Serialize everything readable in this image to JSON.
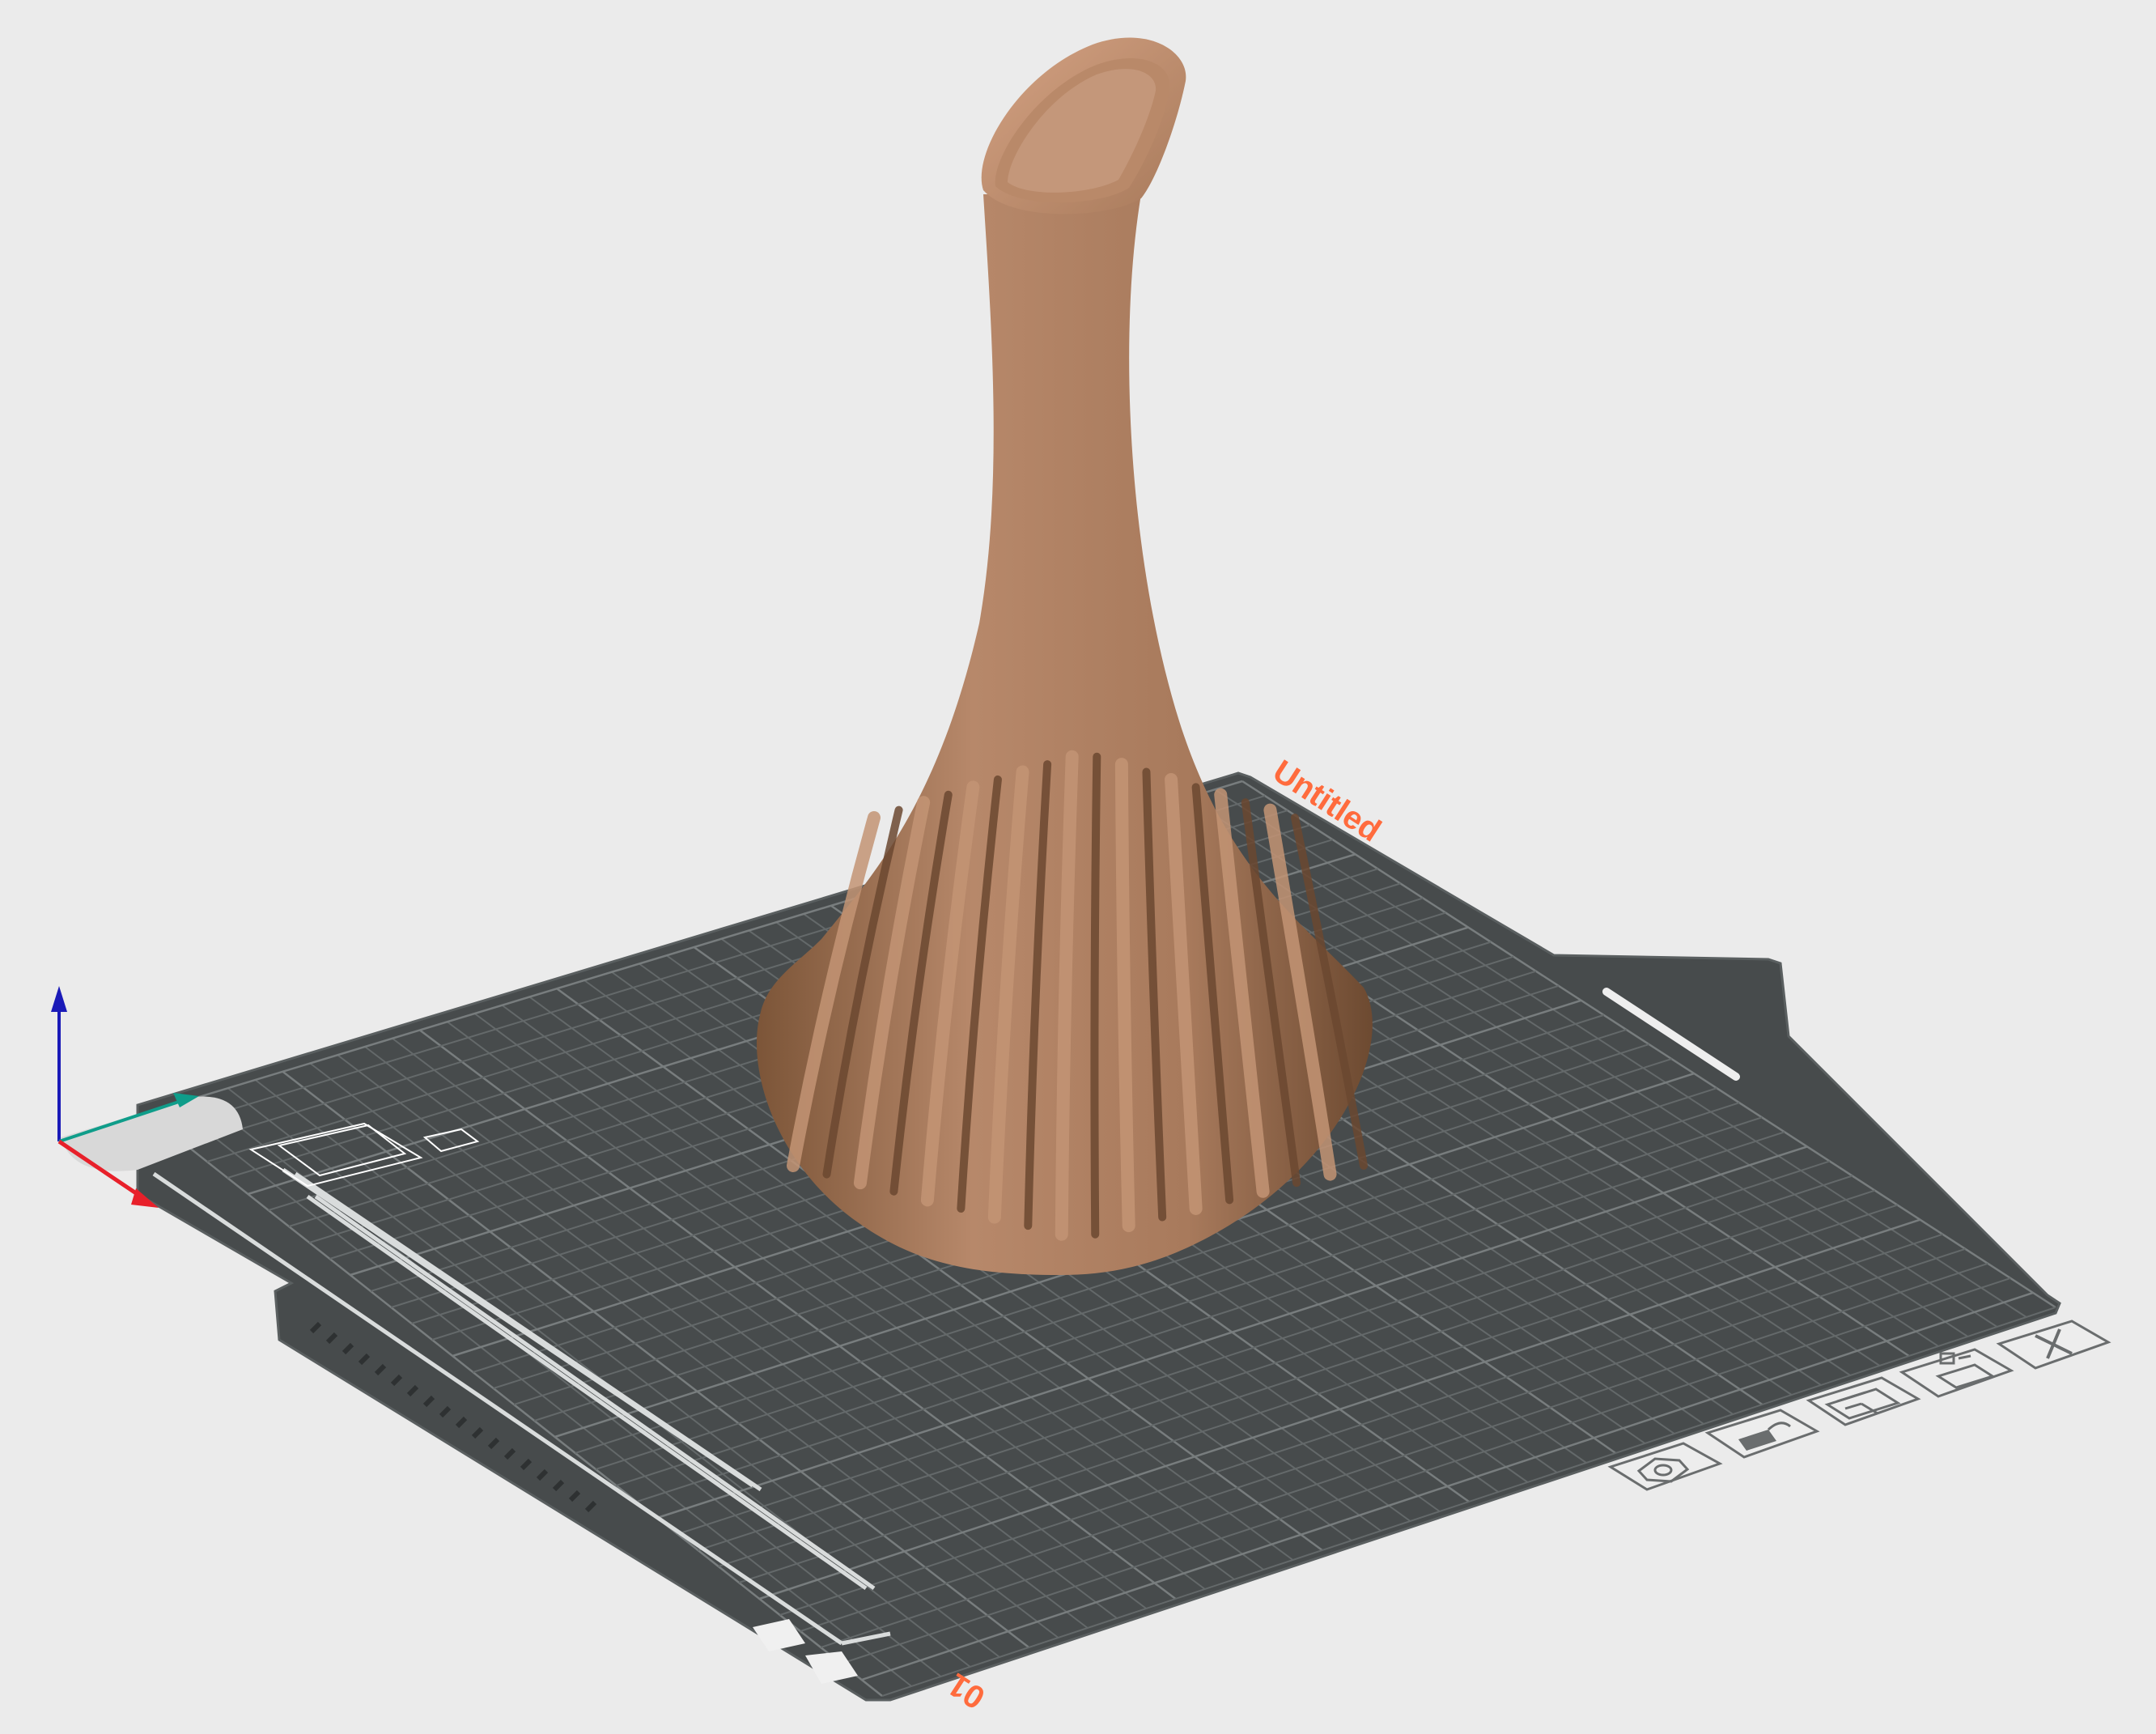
{
  "plate": {
    "name": "Untitled",
    "number": "01"
  },
  "colors": {
    "background": "#ebebeb",
    "bed": "#474b4c",
    "bed_outline": "#5a5f60",
    "grid": "#64696a",
    "model": "#a8795a",
    "label_accent": "#ff6b3d",
    "axis_x": "#e8202a",
    "axis_y": "#0f9d8a",
    "axis_z": "#1a1ab8"
  },
  "plate_icons": [
    {
      "name": "auto-orient-icon",
      "title": "hexagon-nut"
    },
    {
      "name": "lock-plate-icon",
      "title": "lock"
    },
    {
      "name": "arrange-icon",
      "title": "arrange"
    },
    {
      "name": "plate-settings-icon",
      "title": "settings"
    },
    {
      "name": "delete-plate-icon",
      "title": "close"
    }
  ]
}
